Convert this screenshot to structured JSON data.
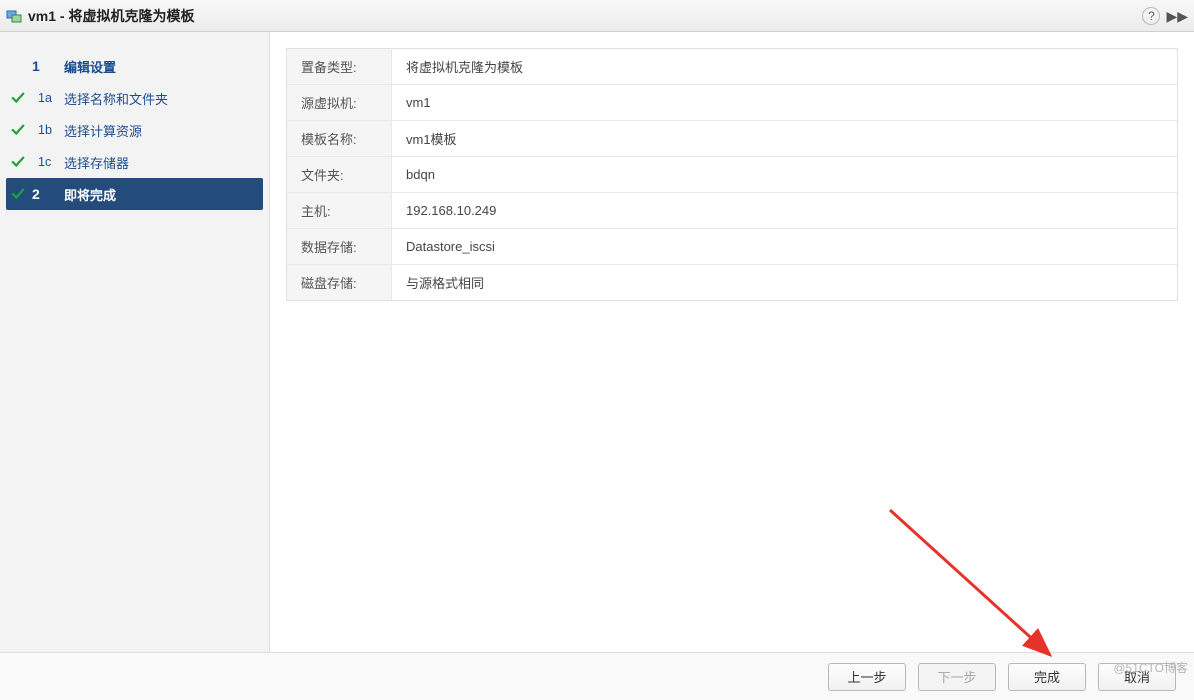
{
  "window": {
    "title": "vm1 - 将虚拟机克隆为模板"
  },
  "sidebar": {
    "steps": [
      {
        "num": "1",
        "label": "编辑设置",
        "type": "main",
        "checked": false
      },
      {
        "num": "1a",
        "label": "选择名称和文件夹",
        "type": "sub",
        "checked": true
      },
      {
        "num": "1b",
        "label": "选择计算资源",
        "type": "sub",
        "checked": true
      },
      {
        "num": "1c",
        "label": "选择存储器",
        "type": "sub",
        "checked": true
      },
      {
        "num": "2",
        "label": "即将完成",
        "type": "main",
        "checked": true,
        "active": true
      }
    ]
  },
  "summary": {
    "rows": [
      {
        "key": "置备类型:",
        "value": "将虚拟机克隆为模板"
      },
      {
        "key": "源虚拟机:",
        "value": "vm1"
      },
      {
        "key": "模板名称:",
        "value": "vm1模板"
      },
      {
        "key": "文件夹:",
        "value": "bdqn"
      },
      {
        "key": "主机:",
        "value": "192.168.10.249"
      },
      {
        "key": "数据存储:",
        "value": "Datastore_iscsi"
      },
      {
        "key": "磁盘存储:",
        "value": "与源格式相同"
      }
    ]
  },
  "footer": {
    "back": "上一步",
    "next": "下一步",
    "finish": "完成",
    "cancel": "取消"
  },
  "watermark": "@51CTO博客"
}
